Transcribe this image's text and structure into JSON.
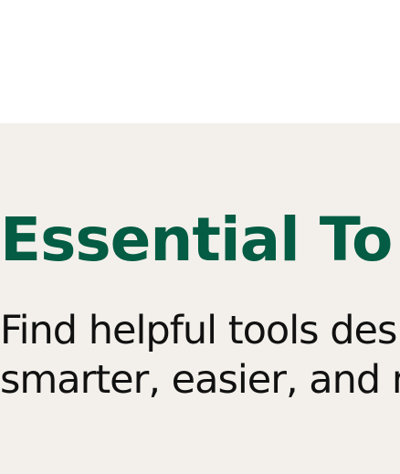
{
  "section": {
    "heading": "Essential To",
    "description_lines": [
      "Find helpful tools desi",
      "smarter, easier, and m"
    ]
  },
  "colors": {
    "page_background": "#ffffff",
    "section_background": "#f3f0eb",
    "heading": "#035c43",
    "body_text": "#111111"
  }
}
